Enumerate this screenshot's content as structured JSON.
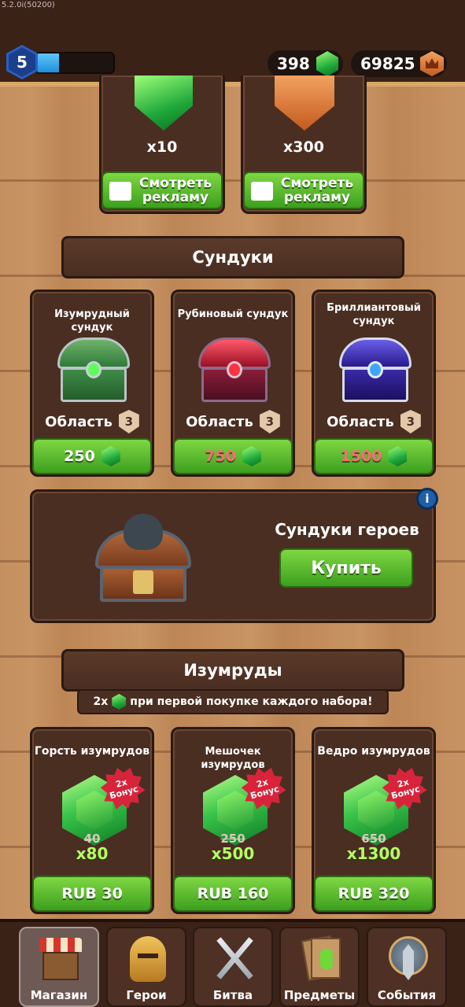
{
  "version": "5.2.0i(50200)",
  "player": {
    "level": "5",
    "xp_fraction": 0.3
  },
  "currencies": {
    "gems": "398",
    "crowns": "69825"
  },
  "ads": [
    {
      "amount": "x10",
      "label_line1": "Смотреть",
      "label_line2": "рекламу"
    },
    {
      "amount": "x300",
      "label_line1": "Смотреть",
      "label_line2": "рекламу"
    }
  ],
  "chests_section": {
    "title": "Сундуки"
  },
  "chests": [
    {
      "title": "Изумрудный сундук",
      "area_label": "Область",
      "area": "3",
      "price": "250",
      "price_color": "#ffffff"
    },
    {
      "title": "Рубиновый сундук",
      "area_label": "Область",
      "area": "3",
      "price": "750",
      "price_color": "#ff6b78"
    },
    {
      "title_line1": "Бриллиантовый",
      "title_line2": "сундук",
      "area_label": "Область",
      "area": "3",
      "price": "1500",
      "price_color": "#ff6b78"
    }
  ],
  "hero_chests": {
    "title": "Сундуки героев",
    "buy_label": "Купить",
    "info": "i"
  },
  "gems_section": {
    "title": "Изумруды",
    "promo_multiplier": "2x",
    "promo_text": "при первой покупке каждого набора!"
  },
  "gem_packs": [
    {
      "title": "Горсть изумрудов",
      "bonus_top": "2x",
      "bonus_bottom": "Бонус",
      "old": "40",
      "new": "x80",
      "price": "RUB 30"
    },
    {
      "title": "Мешочек изумрудов",
      "bonus_top": "2x",
      "bonus_bottom": "Бонус",
      "old": "250",
      "new": "x500",
      "price": "RUB 160"
    },
    {
      "title": "Ведро изумрудов",
      "bonus_top": "2x",
      "bonus_bottom": "Бонус",
      "old": "650",
      "new": "x1300",
      "price": "RUB 320"
    }
  ],
  "nav": [
    {
      "label": "Магазин",
      "icon": "shop-icon",
      "active": true
    },
    {
      "label": "Герои",
      "icon": "helmet-icon",
      "active": false
    },
    {
      "label": "Битва",
      "icon": "swords-icon",
      "active": false
    },
    {
      "label": "Предметы",
      "icon": "cards-icon",
      "active": false
    },
    {
      "label": "События",
      "icon": "emblem-icon",
      "active": false
    }
  ]
}
